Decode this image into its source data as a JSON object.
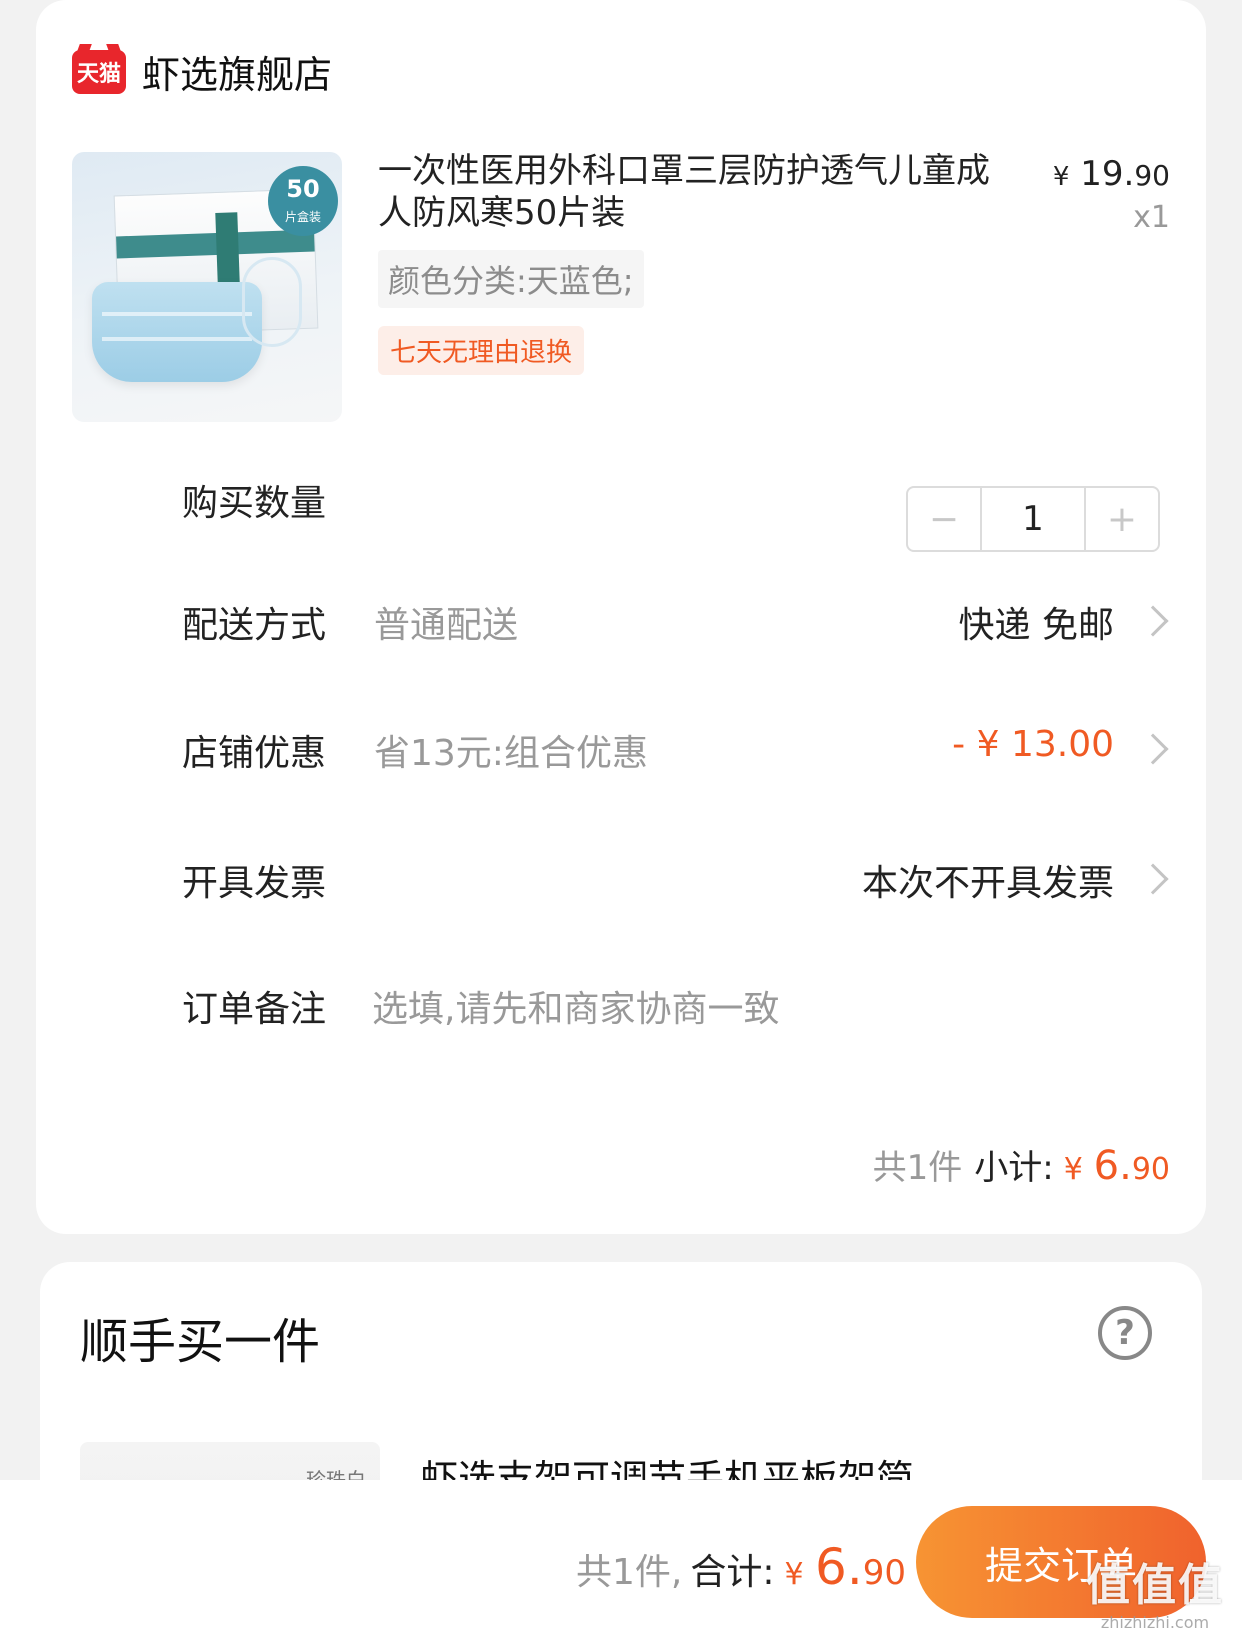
{
  "colors": {
    "accent": "#f05a23",
    "tmall_red": "#e8262c",
    "button_start": "#f79433",
    "button_end": "#f0622d"
  },
  "shop": {
    "badge": "天猫",
    "name": "虾选旗舰店"
  },
  "product": {
    "title": "一次性医用外科口罩三层防护透气儿童成人防风寒50片装",
    "price_yen": "¥",
    "price_int": "19.",
    "price_dec": "90",
    "qty": "x1",
    "sku": "颜色分类:天蓝色;",
    "return_tag": "七天无理由退换",
    "image_badge_number": "50",
    "image_badge_text": "片盒装"
  },
  "quantity": {
    "label": "购买数量",
    "minus": "−",
    "value": "1",
    "plus": "+"
  },
  "shipping": {
    "label": "配送方式",
    "sub": "普通配送",
    "value": "快递 免邮"
  },
  "discount": {
    "label": "店铺优惠",
    "sub": "省13元:组合优惠",
    "value": "- ¥ 13.00"
  },
  "invoice": {
    "label": "开具发票",
    "value": "本次不开具发票"
  },
  "note": {
    "label": "订单备注",
    "placeholder": "选填,请先和商家协商一致"
  },
  "subtotal": {
    "count": "共1件",
    "label": "小计:",
    "yen": "¥",
    "int": "6.",
    "dec": "90"
  },
  "addon": {
    "title": "顺手买一件",
    "help_icon": "?",
    "product_title": "虾选支架可调节手机平板架简",
    "image_label": "珍珠白"
  },
  "bottom": {
    "count": "共1件,",
    "total_label": "合计:",
    "yen": "¥",
    "int": "6.",
    "dec": "90",
    "submit": "提交订单"
  },
  "watermark": {
    "main": "值值值",
    "sub": "zhizhizhi.com"
  }
}
